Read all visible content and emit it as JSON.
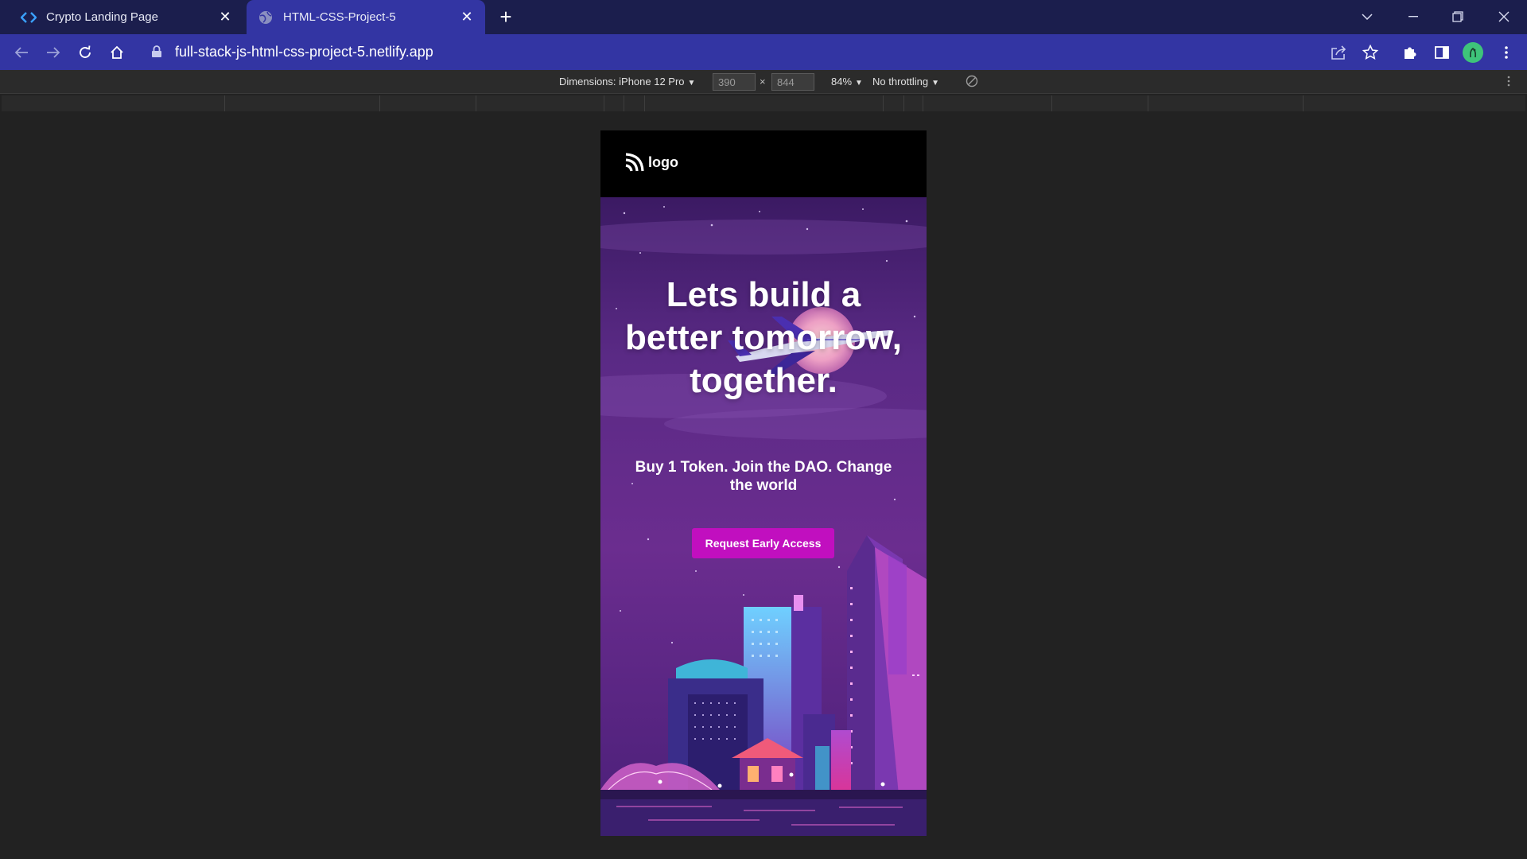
{
  "browser": {
    "tabs": [
      {
        "title": "Crypto Landing Page",
        "active": false,
        "icon": "code-brackets-icon"
      },
      {
        "title": "HTML-CSS-Project-5",
        "active": true,
        "icon": "globe-icon"
      }
    ],
    "url": "full-stack-js-html-css-project-5.netlify.app",
    "colors": {
      "tabstrip": "#1b1e4d",
      "toolbar": "#3335a3",
      "avatar": "#3ec47a"
    }
  },
  "device_toolbar": {
    "dimensions_label": "Dimensions: iPhone 12 Pro",
    "width_value": "390",
    "height_value": "844",
    "times": "×",
    "zoom": "84%",
    "throttling": "No throttling"
  },
  "site": {
    "logo_text": "logo",
    "hero_title": "Lets build a better tomorrow, together.",
    "hero_subtitle": "Buy 1 Token. Join the DAO. Change the world",
    "cta_label": "Request Early Access",
    "colors": {
      "header": "#000000",
      "cta": "#c10fbf",
      "sky": "#4b2470"
    }
  }
}
